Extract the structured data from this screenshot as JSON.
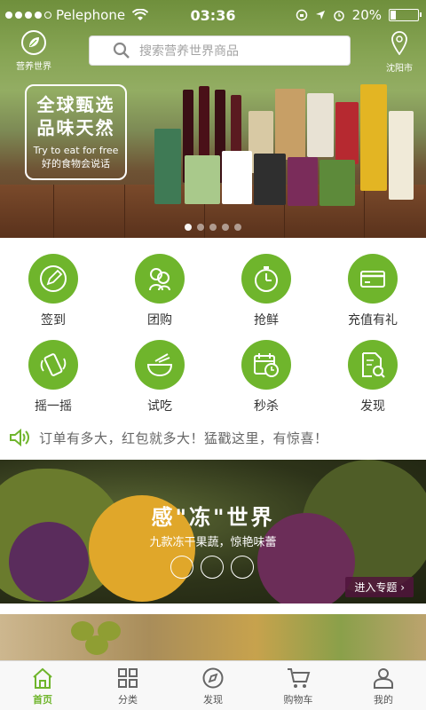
{
  "status_bar": {
    "carrier": "Pelephone",
    "time": "03:36",
    "battery": "20%"
  },
  "header": {
    "brand_label": "营养世界",
    "search_placeholder": "搜索营养世界商品",
    "location": "沈阳市"
  },
  "banner": {
    "line1": "全球甄选",
    "line2": "品味天然",
    "line3": "Try to eat for free",
    "line4": "好的食物会说话",
    "pages": 5,
    "active_page": 0
  },
  "features": [
    {
      "label": "签到",
      "icon": "pen-icon"
    },
    {
      "label": "团购",
      "icon": "group-icon"
    },
    {
      "label": "抢鲜",
      "icon": "stopwatch-icon"
    },
    {
      "label": "充值有礼",
      "icon": "card-icon"
    },
    {
      "label": "摇一摇",
      "icon": "shake-phone-icon"
    },
    {
      "label": "试吃",
      "icon": "bowl-icon"
    },
    {
      "label": "秒杀",
      "icon": "calendar-clock-icon"
    },
    {
      "label": "发现",
      "icon": "document-search-icon"
    }
  ],
  "notice": {
    "icon": "speaker-icon",
    "text": "订单有多大，红包就多大！猛戳这里，有惊喜！"
  },
  "promo": {
    "title": "感\"冻\"世界",
    "subtitle": "九款冻干果蔬，惊艳味蕾",
    "button": "进入专题 ›"
  },
  "tabbar": [
    {
      "label": "首页",
      "icon": "home-icon",
      "active": true
    },
    {
      "label": "分类",
      "icon": "grid-icon",
      "active": false
    },
    {
      "label": "发现",
      "icon": "compass-icon",
      "active": false
    },
    {
      "label": "购物车",
      "icon": "cart-icon",
      "active": false
    },
    {
      "label": "我的",
      "icon": "user-icon",
      "active": false
    }
  ],
  "colors": {
    "accent": "#6fb52c",
    "text_gray": "#666666"
  }
}
